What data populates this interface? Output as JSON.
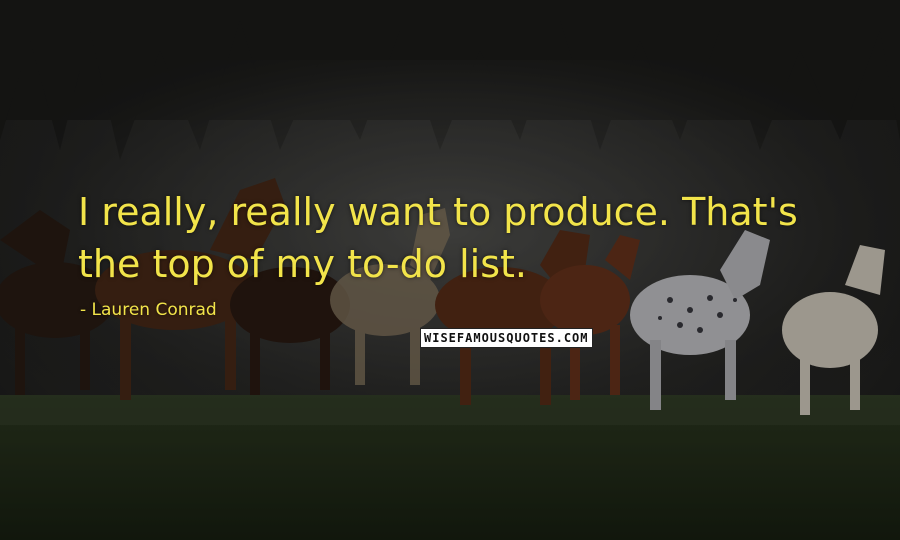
{
  "quote": {
    "text": "I really, really want to produce. That's the top of my to-do list.",
    "author": "- Lauren Conrad",
    "color": "#f2e44a"
  },
  "watermark": {
    "text": "WISEFAMOUSQUOTES.COM"
  },
  "background": {
    "subject": "herd of running horses in a misty field"
  }
}
